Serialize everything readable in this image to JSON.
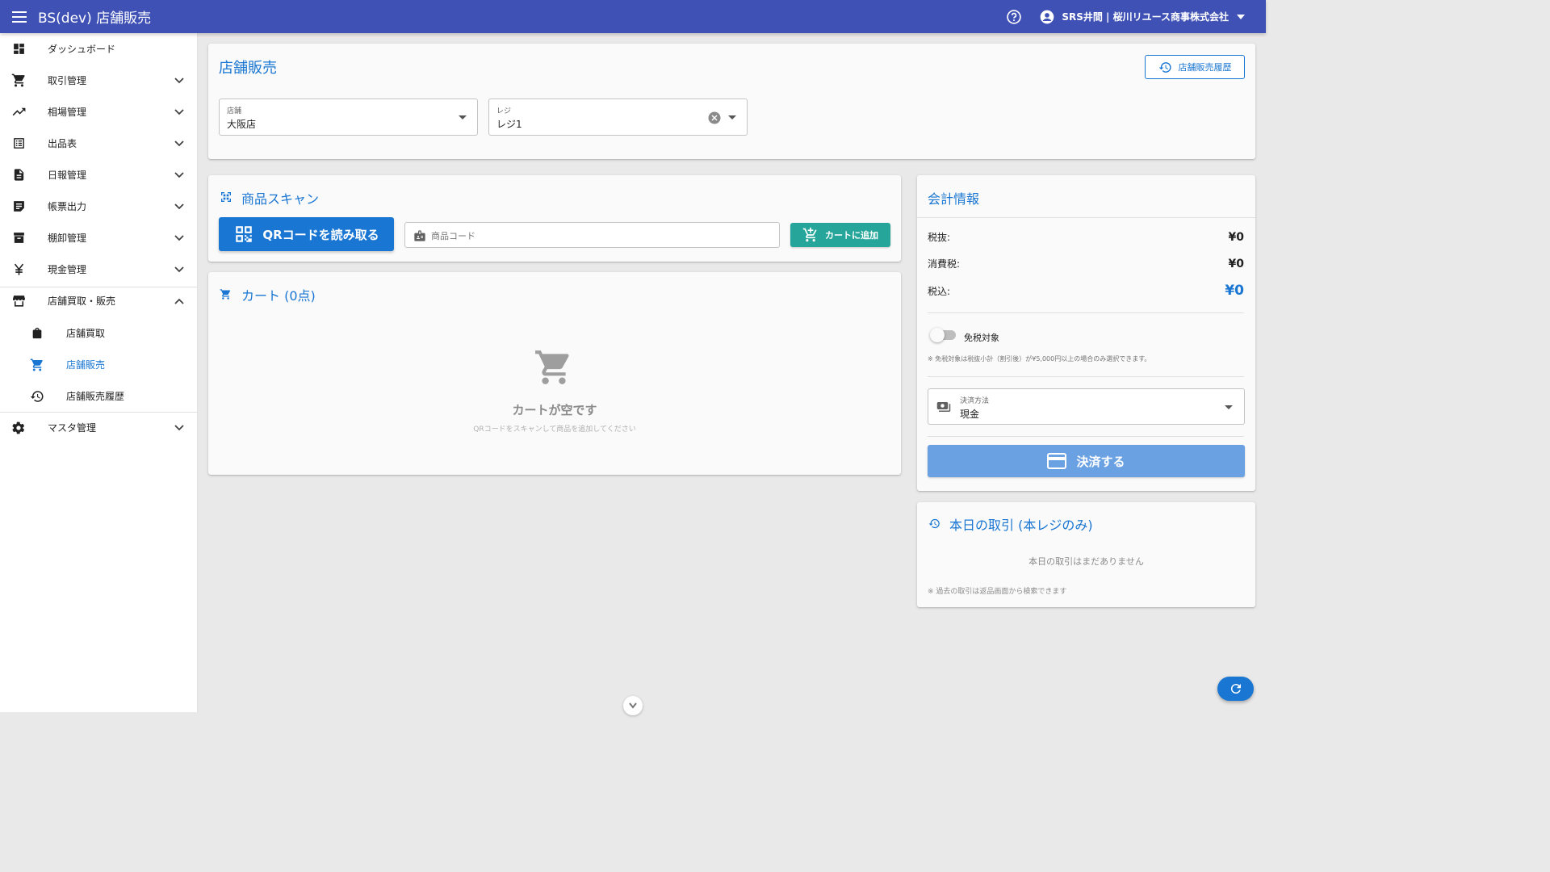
{
  "appbar": {
    "title": "BS(dev) 店舗販売",
    "account": "SRS井間 | 桜川リユース商事株式会社"
  },
  "sidebar": {
    "items": [
      {
        "label": "ダッシュボード",
        "icon": "dashboard-icon"
      },
      {
        "label": "取引管理",
        "icon": "cart-icon"
      },
      {
        "label": "相場管理",
        "icon": "trending-up-icon"
      },
      {
        "label": "出品表",
        "icon": "list-icon"
      },
      {
        "label": "日報管理",
        "icon": "document-icon"
      },
      {
        "label": "帳票出力",
        "icon": "note-icon"
      },
      {
        "label": "棚卸管理",
        "icon": "archive-icon"
      },
      {
        "label": "現金管理",
        "icon": "yen-icon"
      },
      {
        "label": "店舗買取・販売",
        "icon": "store-icon"
      },
      {
        "label": "店舗買取",
        "icon": "shopping-bag-icon"
      },
      {
        "label": "店舗販売",
        "icon": "cart-icon"
      },
      {
        "label": "店舗販売履歴",
        "icon": "history-icon"
      },
      {
        "label": "マスタ管理",
        "icon": "gear-icon"
      }
    ]
  },
  "header_card": {
    "title": "店舗販売",
    "history_button": "店舗販売履歴",
    "store": {
      "label": "店舗",
      "value": "大阪店"
    },
    "register": {
      "label": "レジ",
      "value": "レジ1"
    }
  },
  "scan": {
    "title": "商品スキャン",
    "qr_button": "QRコードを読み取る",
    "code_placeholder": "商品コード",
    "add_button": "カートに追加"
  },
  "cart": {
    "title": "カート (0点)",
    "empty_title": "カートが空です",
    "empty_sub": "QRコードをスキャンして商品を追加してください"
  },
  "accounting": {
    "title": "会計情報",
    "subtotal_label": "税抜:",
    "subtotal_value": "¥0",
    "tax_label": "消費税:",
    "tax_value": "¥0",
    "total_label": "税込:",
    "total_value": "¥0",
    "tax_free_label": "免税対象",
    "tax_free_note": "※ 免税対象は税抜小計（割引後）が¥5,000円以上の場合のみ選択できます。",
    "payment_label": "決済方法",
    "payment_value": "現金",
    "pay_button": "決済する"
  },
  "today": {
    "title": "本日の取引 (本レジのみ)",
    "empty": "本日の取引はまだありません",
    "note": "※ 過去の取引は返品画面から検索できます"
  },
  "colors": {
    "appbar": "#3f51b5",
    "primary": "#1976d2",
    "teal": "#26a69a",
    "pay_disabled": "#6aa1e3"
  }
}
